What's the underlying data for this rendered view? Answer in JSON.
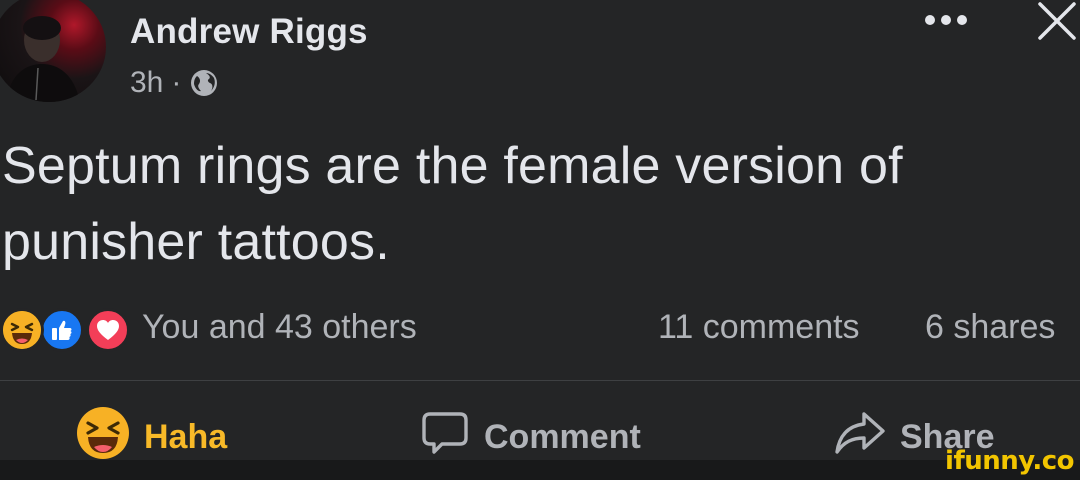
{
  "post": {
    "author": "Andrew Riggs",
    "time": "3h",
    "separator": "·",
    "audience_icon": "globe-icon",
    "text": "Septum rings are the female version of punisher tattoos."
  },
  "header_actions": {
    "more_icon": "more-horizontal-icon",
    "close_icon": "close-icon"
  },
  "reactions": {
    "icons": [
      "haha-reaction-icon",
      "like-reaction-icon",
      "love-reaction-icon"
    ],
    "summary": "You and 43 others",
    "comments": "11 comments",
    "shares": "6 shares"
  },
  "actions": {
    "haha_label": "Haha",
    "comment_label": "Comment",
    "share_label": "Share"
  },
  "colors": {
    "background": "#242526",
    "text_primary": "#e4e6eb",
    "text_secondary": "#b0b3b8",
    "haha_accent": "#f7b928",
    "like_blue": "#1877f2",
    "love_red": "#f33e58",
    "watermark": "#f2c500"
  },
  "watermark": {
    "text": "ifunny.co"
  }
}
